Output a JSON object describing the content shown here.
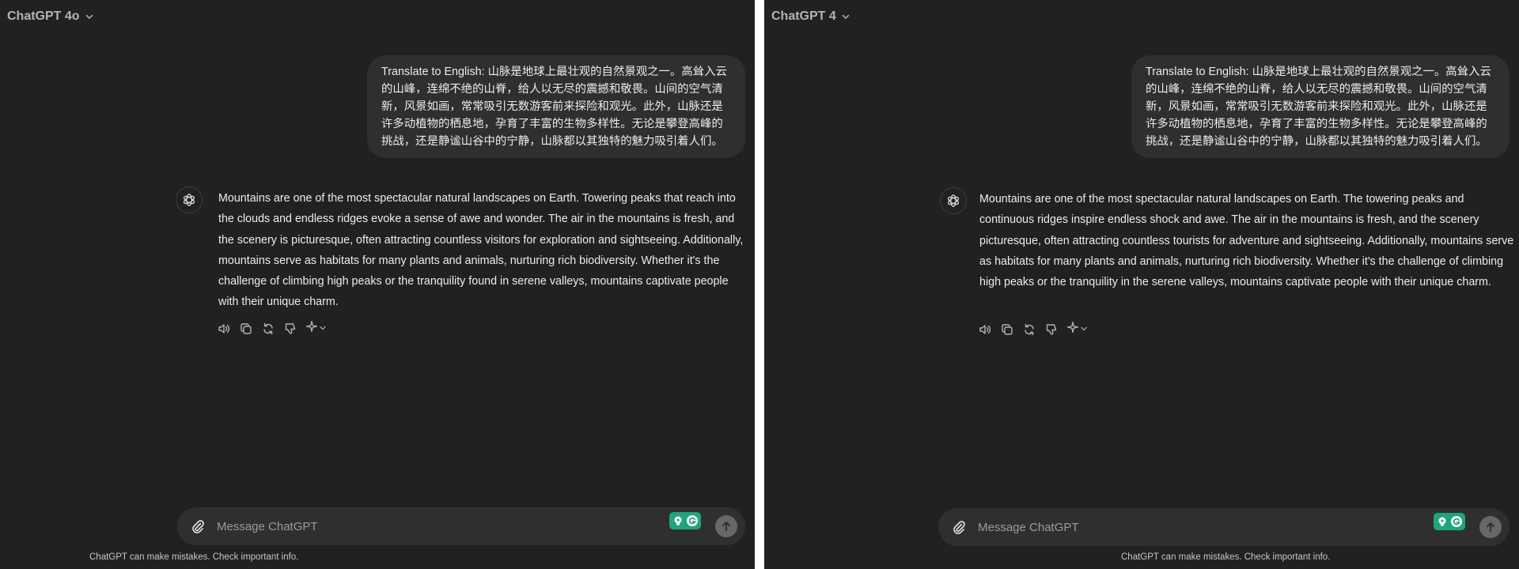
{
  "colors": {
    "background": "#212121",
    "bubble": "#2f2f2f",
    "text": "#ececec",
    "muted": "#b4b4b4",
    "extension_green": "#1fa57b",
    "send_button": "#676767"
  },
  "icons": {
    "model_chevron": "chevron-down-icon",
    "avatar": "openai-logo-icon",
    "read_aloud": "speaker-icon",
    "copy": "copy-icon",
    "regenerate": "refresh-icon",
    "dislike": "thumbs-down-icon",
    "change_model": "sparkle-icon",
    "attach": "paperclip-icon",
    "send": "arrow-up-icon"
  },
  "panes": [
    {
      "model_name": "ChatGPT 4o",
      "user_message": "Translate to English: 山脉是地球上最壮观的自然景观之一。高耸入云的山峰，连绵不绝的山脊，给人以无尽的震撼和敬畏。山间的空气清新，风景如画，常常吸引无数游客前来探险和观光。此外，山脉还是许多动植物的栖息地，孕育了丰富的生物多样性。无论是攀登高峰的挑战，还是静谧山谷中的宁静，山脉都以其独特的魅力吸引着人们。",
      "assistant_message": "Mountains are one of the most spectacular natural landscapes on Earth. Towering peaks that reach into the clouds and endless ridges evoke a sense of awe and wonder. The air in the mountains is fresh, and the scenery is picturesque, often attracting countless visitors for exploration and sightseeing. Additionally, mountains serve as habitats for many plants and animals, nurturing rich biodiversity. Whether it's the challenge of climbing high peaks or the tranquility found in serene valleys, mountains captivate people with their unique charm.",
      "composer_placeholder": "Message ChatGPT",
      "disclaimer": "ChatGPT can make mistakes. Check important info."
    },
    {
      "model_name": "ChatGPT 4",
      "user_message": "Translate to English: 山脉是地球上最壮观的自然景观之一。高耸入云的山峰，连绵不绝的山脊，给人以无尽的震撼和敬畏。山间的空气清新，风景如画，常常吸引无数游客前来探险和观光。此外，山脉还是许多动植物的栖息地，孕育了丰富的生物多样性。无论是攀登高峰的挑战，还是静谧山谷中的宁静，山脉都以其独特的魅力吸引着人们。",
      "assistant_message": "Mountains are one of the most spectacular natural landscapes on Earth. The towering peaks and continuous ridges inspire endless shock and awe. The air in the mountains is fresh, and the scenery picturesque, often attracting countless tourists for adventure and sightseeing. Additionally, mountains serve as habitats for many plants and animals, nurturing rich biodiversity. Whether it's the challenge of climbing high peaks or the tranquility in the serene valleys, mountains captivate people with their unique charm.",
      "composer_placeholder": "Message ChatGPT",
      "disclaimer": "ChatGPT can make mistakes. Check important info."
    }
  ]
}
